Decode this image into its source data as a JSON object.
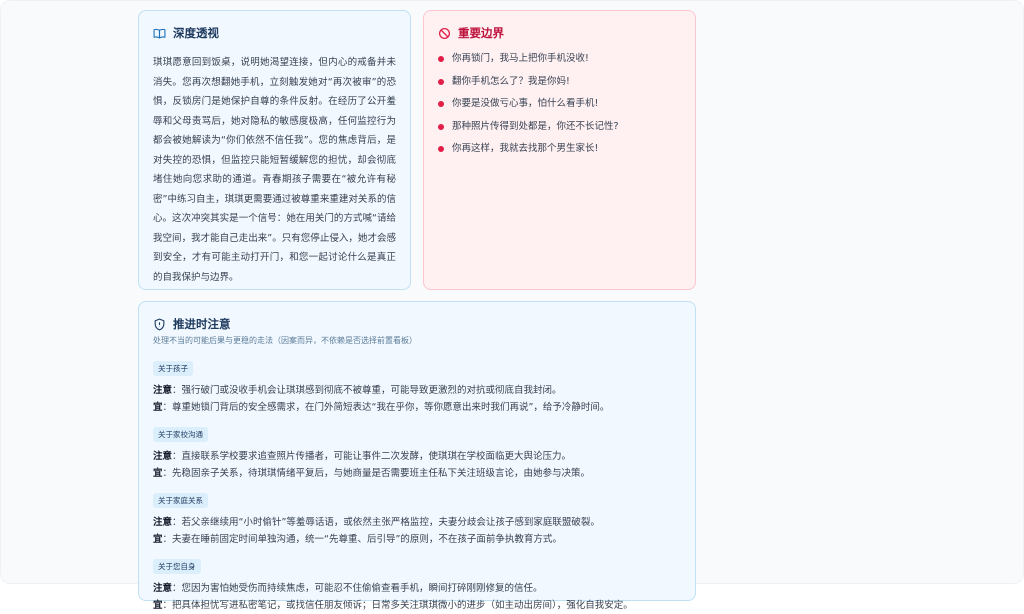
{
  "insight": {
    "title": "深度透视",
    "icon": "book-open-icon",
    "body": "琪琪愿意回到饭桌，说明她渴望连接，但内心的戒备并未消失。您再次想翻她手机，立刻触发她对“再次被审”的恐惧，反锁房门是她保护自尊的条件反射。在经历了公开羞辱和父母责骂后，她对隐私的敏感度极高，任何监控行为都会被她解读为“你们依然不信任我”。您的焦虑背后，是对失控的恐惧，但监控只能短暂缓解您的担忧，却会彻底堵住她向您求助的通道。青春期孩子需要在“被允许有秘密”中练习自主，琪琪更需要通过被尊重来重建对关系的信心。这次冲突其实是一个信号：她在用关门的方式喊“请给我空间，我才能自己走出来”。只有您停止侵入，她才会感到安全，才有可能主动打开门，和您一起讨论什么是真正的自我保护与边界。"
  },
  "boundary": {
    "title": "重要边界",
    "icon": "no-entry-icon",
    "accent": "#e11d48",
    "items": [
      "你再锁门，我马上把你手机没收!",
      "翻你手机怎么了？我是你妈!",
      "你要是没做亏心事，怕什么看手机!",
      "那种照片传得到处都是，你还不长记性?",
      "你再这样，我就去找那个男生家长!"
    ]
  },
  "cautions": {
    "title": "推进时注意",
    "icon": "shield-alert-icon",
    "subtitle": "处理不当的可能后果与更稳的走法（因案而异，不依赖是否选择前置看板）",
    "note_label": "注意",
    "advice_label": "宜",
    "sections": [
      {
        "tag": "关于孩子",
        "note": "：强行破门或没收手机会让琪琪感到彻底不被尊重，可能导致更激烈的对抗或彻底自我封闭。",
        "advice": "：尊重她锁门背后的安全感需求，在门外简短表达“我在乎你，等你愿意出来时我们再说”，给予冷静时间。"
      },
      {
        "tag": "关于家校沟通",
        "note": "：直接联系学校要求追查照片传播者，可能让事件二次发酵，使琪琪在学校面临更大舆论压力。",
        "advice": "：先稳固亲子关系，待琪琪情绪平复后，与她商量是否需要班主任私下关注班级言论，由她参与决策。"
      },
      {
        "tag": "关于家庭关系",
        "note": "：若父亲继续用“小时偷针”等羞辱话语，或依然主张严格监控，夫妻分歧会让孩子感到家庭联盟破裂。",
        "advice": "：夫妻在睡前固定时间单独沟通，统一“先尊重、后引导”的原则，不在孩子面前争执教育方式。"
      },
      {
        "tag": "关于您自身",
        "note": "：您因为害怕她受伤而持续焦虑，可能忍不住偷偷查看手机，瞬间打碎刚刚修复的信任。",
        "advice": "：把具体担忧写进私密笔记，或找信任朋友倾诉；日常多关注琪琪微小的进步（如主动出房间），强化自我安定。"
      }
    ]
  }
}
